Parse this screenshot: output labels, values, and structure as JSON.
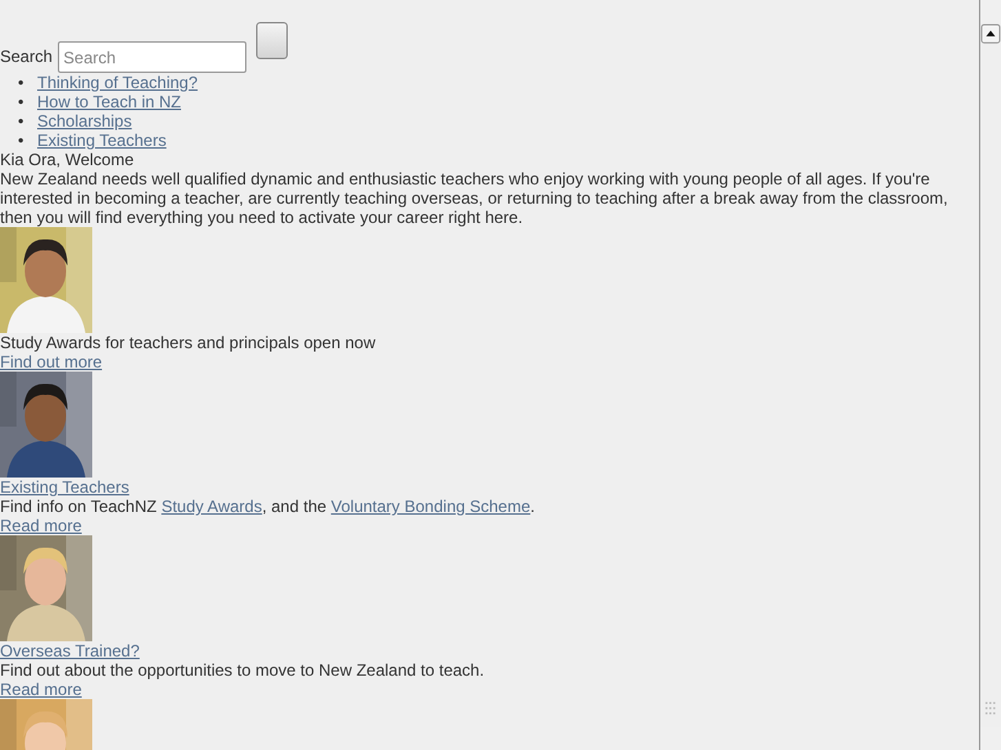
{
  "search": {
    "label": "Search",
    "placeholder": "Search"
  },
  "nav": [
    {
      "marker": "•",
      "label": "Thinking of Teaching?"
    },
    {
      "marker": "•",
      "label": "How to Teach in NZ"
    },
    {
      "marker": "•",
      "label": "Scholarships"
    },
    {
      "marker": "•",
      "label": "Existing Teachers"
    }
  ],
  "welcome": {
    "heading": "Kia Ora, Welcome",
    "text": "New Zealand needs well qualified dynamic and enthusiastic teachers who enjoy working with young people of all ages. If you're interested in becoming a teacher, are currently teaching overseas, or returning to teaching after a break away from the classroom, then you will find everything you need to activate your career right here."
  },
  "features": [
    {
      "blocks": [
        {
          "kind": "picture"
        },
        {
          "kind": "text",
          "text": "Study Awards for teachers and principals open now"
        },
        {
          "kind": "link",
          "text": "Find out more "
        }
      ]
    },
    {
      "blocks": [
        {
          "kind": "picture"
        },
        {
          "kind": "link",
          "text": "Existing Teachers"
        },
        {
          "kind": "paragraph",
          "parts": [
            {
              "text": "Find info on TeachNZ "
            },
            {
              "link": "Study Awards"
            },
            {
              "text": ", and the "
            },
            {
              "link": "Voluntary Bonding Scheme"
            },
            {
              "text": "."
            }
          ]
        },
        {
          "kind": "link",
          "text": "Read more"
        }
      ]
    },
    {
      "blocks": [
        {
          "kind": "picture"
        },
        {
          "kind": "link",
          "text": "Overseas Trained?"
        },
        {
          "kind": "text",
          "text": "Find out about the opportunities to move to New Zealand to teach."
        },
        {
          "kind": "link",
          "text": "Read more"
        }
      ]
    },
    {
      "blocks": [
        {
          "kind": "picture"
        }
      ]
    }
  ]
}
